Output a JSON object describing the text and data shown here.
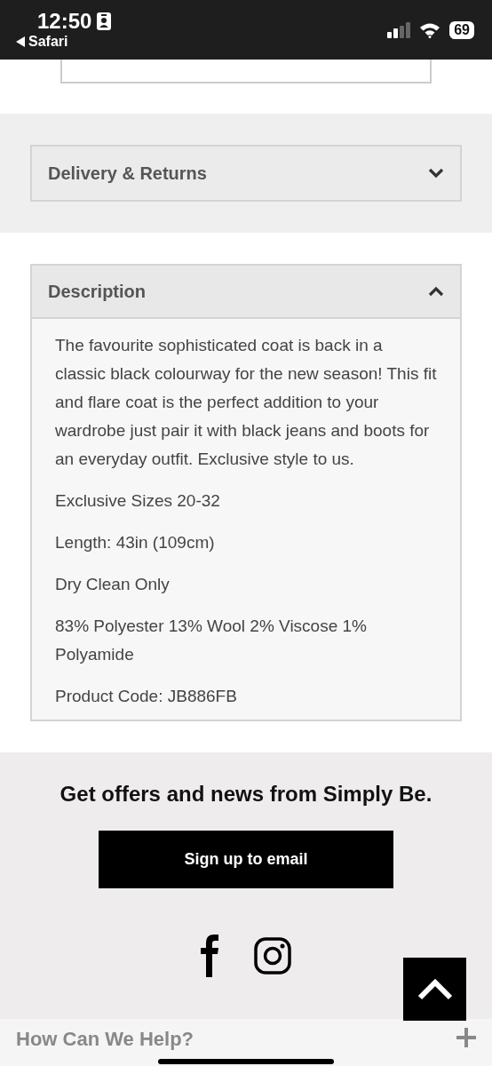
{
  "status_bar": {
    "time": "12:50",
    "back_label": "Safari",
    "battery": "69"
  },
  "accordions": [
    {
      "title": "Delivery & Returns",
      "expanded": false
    },
    {
      "title": "Description",
      "expanded": true,
      "paragraphs": [
        "The favourite sophisticated coat is back in a classic black colourway for the new season! This fit and flare coat is the perfect addition to your wardrobe just pair it with black jeans and boots for an everyday outfit. Exclusive style to us.",
        "Exclusive Sizes 20-32",
        "Length: 43in (109cm)",
        "Dry Clean Only",
        "83% Polyester 13% Wool 2% Viscose 1% Polyamide",
        "Product Code: JB886FB"
      ]
    }
  ],
  "newsletter": {
    "heading": "Get offers and news from Simply Be.",
    "button": "Sign up to email"
  },
  "footer": {
    "title": "How Can We Help?",
    "expanded": false
  }
}
